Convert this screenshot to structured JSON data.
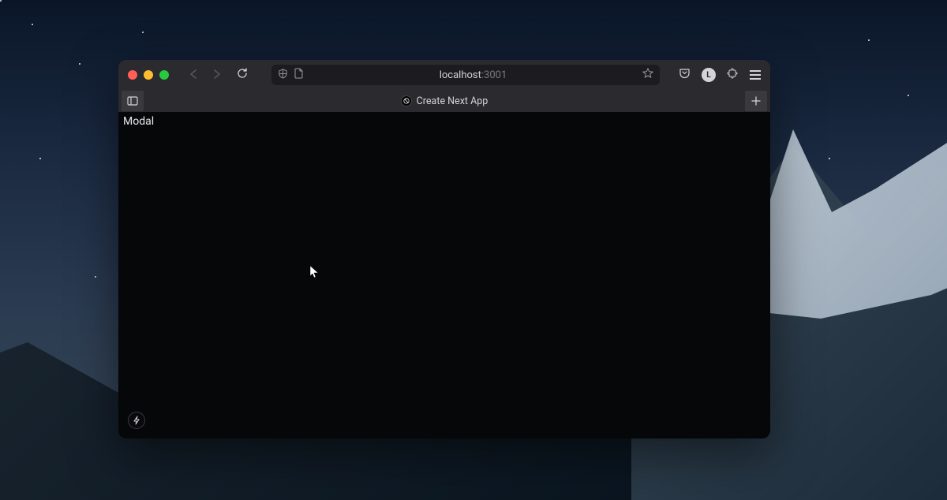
{
  "url": {
    "host": "localhost",
    "port": ":3001"
  },
  "tab": {
    "title": "Create Next App"
  },
  "content": {
    "text": "Modal"
  },
  "account": {
    "initial": "L"
  }
}
